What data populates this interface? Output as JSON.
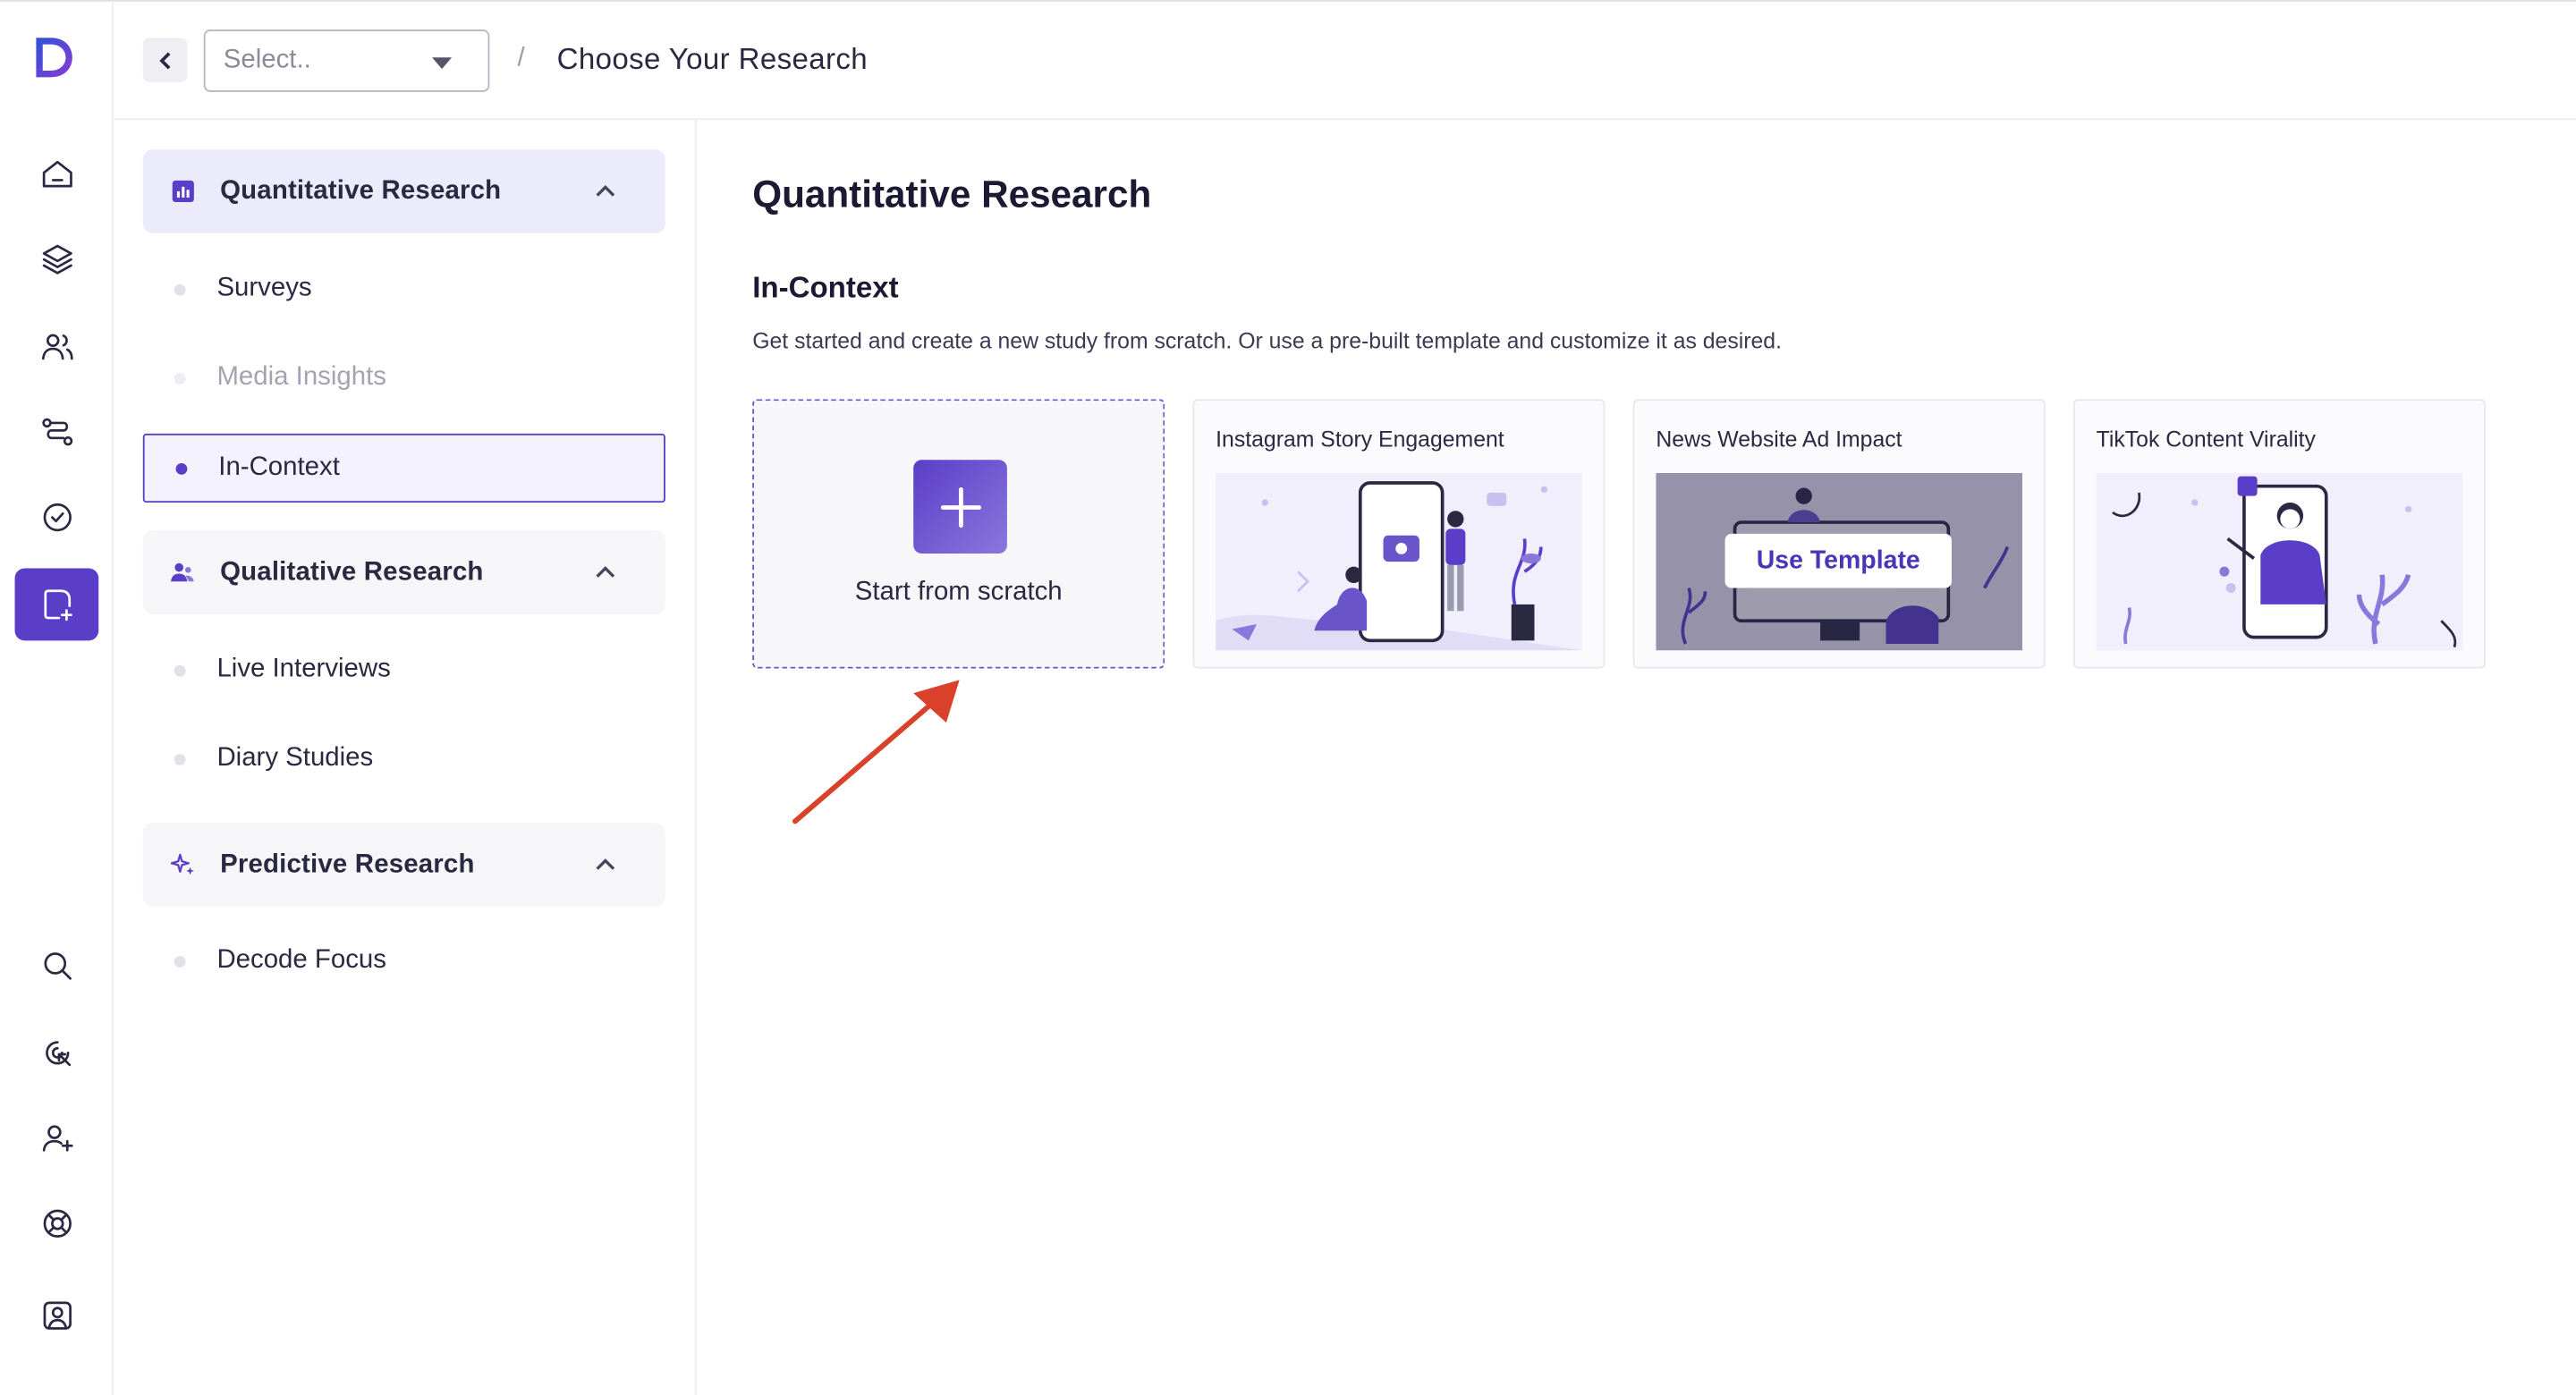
{
  "topbar": {
    "select_placeholder": "Select..",
    "breadcrumb_separator": "/",
    "breadcrumb_title": "Choose Your Research"
  },
  "rail": {
    "top_items": [
      "home-icon",
      "layers-icon",
      "users-icon",
      "route-icon",
      "check-badge-icon",
      "new-study-icon"
    ],
    "bottom_items": [
      "search-icon",
      "click-icon",
      "add-user-icon",
      "help-lifebuoy-icon",
      "profile-icon"
    ],
    "active": "new-study-icon",
    "accent": "#5a3ec8"
  },
  "sidebar": {
    "groups": [
      {
        "label": "Quantitative Research",
        "icon": "bar-chart-icon",
        "items": [
          {
            "label": "Surveys"
          },
          {
            "label": "Media Insights"
          },
          {
            "label": "In-Context"
          }
        ]
      },
      {
        "label": "Qualitative Research",
        "icon": "people-icon",
        "items": [
          {
            "label": "Live Interviews"
          },
          {
            "label": "Diary Studies"
          }
        ]
      },
      {
        "label": "Predictive Research",
        "icon": "sparkle-icon",
        "items": [
          {
            "label": "Decode Focus"
          }
        ]
      }
    ],
    "selected_item": "In-Context"
  },
  "main": {
    "title": "Quantitative Research",
    "section_title": "In-Context",
    "description": "Get started and create a new study from scratch. Or use a pre-built template and customize it as desired.",
    "scratch_label": "Start from scratch",
    "templates": [
      {
        "title": "Instagram Story Engagement"
      },
      {
        "title": "News Website Ad Impact",
        "hover_button": "Use Template"
      },
      {
        "title": "TikTok Content Virality"
      }
    ],
    "annotation_color": "#d9412a"
  }
}
